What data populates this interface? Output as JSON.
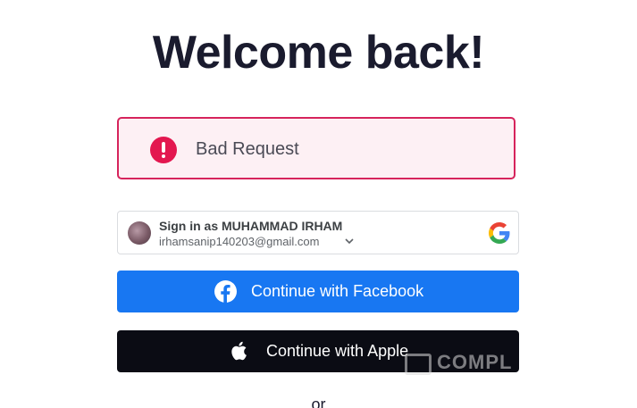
{
  "header": {
    "title": "Welcome back!"
  },
  "error": {
    "message": "Bad Request",
    "color": "#e3174f",
    "icon": "exclamation-circle-icon"
  },
  "google_signin": {
    "name_line": "Sign in as MUHAMMAD IRHAM",
    "email": "irhamsanip140203@gmail.com",
    "icon": "google-logo-icon"
  },
  "facebook": {
    "label": "Continue with Facebook",
    "color": "#1877f2",
    "icon": "facebook-icon"
  },
  "apple": {
    "label": "Continue with Apple",
    "color": "#0b0c14",
    "icon": "apple-icon"
  },
  "watermark": {
    "text": "COMPL"
  },
  "divider": {
    "text": "or"
  }
}
